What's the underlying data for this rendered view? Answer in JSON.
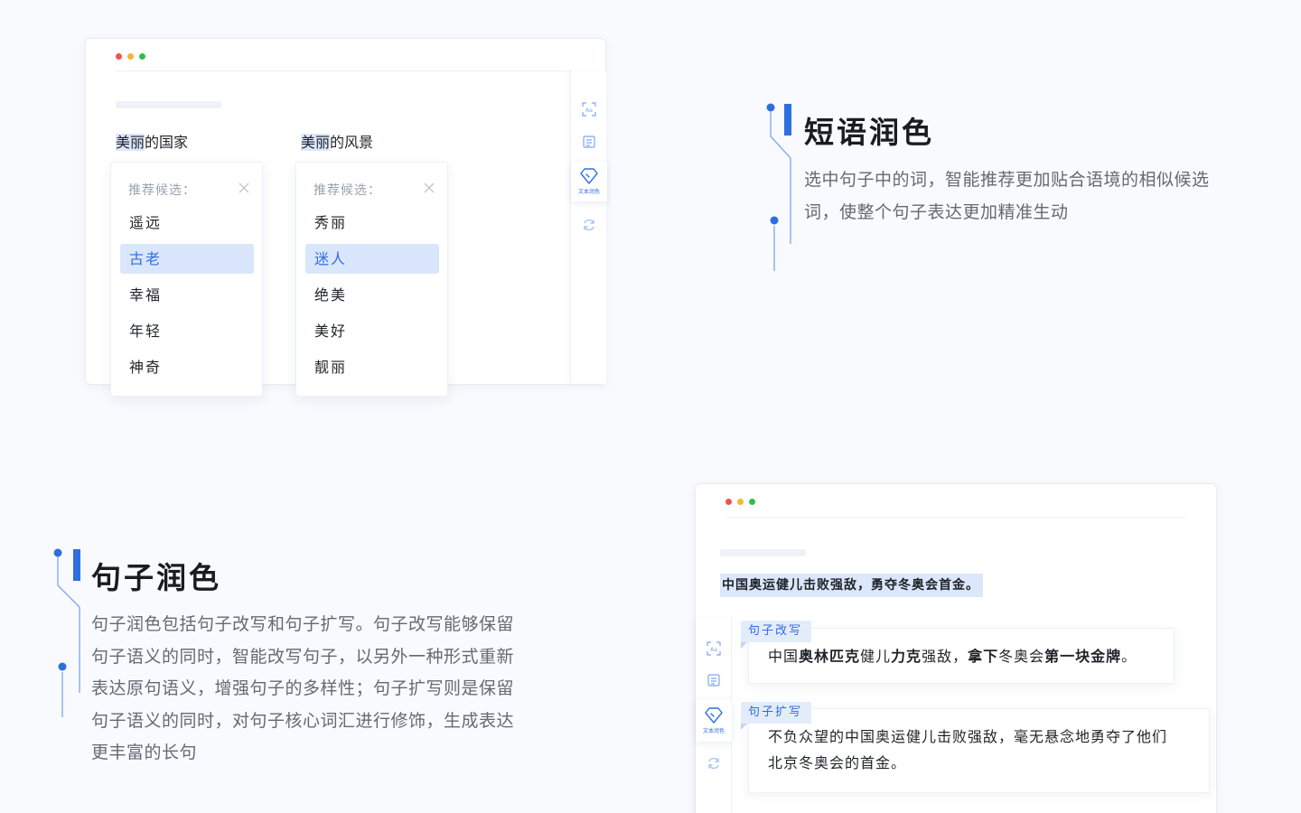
{
  "colors": {
    "accent": "#2f6ee0",
    "dot_red": "#f0544f",
    "dot_yellow": "#f5b72f",
    "dot_green": "#2cc04e"
  },
  "window1": {
    "groups": [
      {
        "head_highlight": "美丽",
        "head_rest": "的国家",
        "title": "推荐候选：",
        "items": [
          "遥远",
          "古老",
          "幸福",
          "年轻",
          "神奇"
        ],
        "selected_index": 1
      },
      {
        "head_highlight": "美丽",
        "head_rest": "的风景",
        "title": "推荐候选：",
        "items": [
          "秀丽",
          "迷人",
          "绝美",
          "美好",
          "靓丽"
        ],
        "selected_index": 1
      }
    ],
    "toolbar": {
      "items": [
        {
          "icon": "text-recognition-icon"
        },
        {
          "icon": "document-icon"
        },
        {
          "icon": "diamond-polish-icon",
          "label": "文本润色",
          "active": true
        },
        {
          "icon": "refresh-icon"
        }
      ]
    }
  },
  "feature_phrase": {
    "title": "短语润色",
    "desc_line1": "选中句子中的词，智能推荐更加贴合语境的相似候选",
    "desc_line2": "词，使整个句子表达更加精准生动"
  },
  "feature_sentence": {
    "title": "句子润色",
    "desc_lines": [
      "句子润色包括句子改写和句子扩写。句子改写能够保留",
      "句子语义的同时，智能改写句子，以另外一种形式重新",
      "表达原句语义，增强句子的多样性；句子扩写则是保留",
      "句子语义的同时，对句子核心词汇进行修饰，生成表达",
      "更丰富的长句"
    ]
  },
  "window2": {
    "selected_sentence": "中国奥运健儿击败强敌，勇夺冬奥会首金。",
    "rewrite": {
      "tag": "句子改写",
      "parts": [
        "中国",
        "奥林匹克",
        "健儿",
        "力克",
        "强敌，",
        "拿下",
        "冬奥会",
        "第一块金牌",
        "。"
      ]
    },
    "expand": {
      "tag": "句子扩写",
      "line1": "不负众望的中国奥运健儿击败强敌，毫无悬念地勇夺了他们",
      "line2": "北京冬奥会的首金。"
    },
    "toolbar": {
      "items": [
        {
          "icon": "text-recognition-icon"
        },
        {
          "icon": "document-icon"
        },
        {
          "icon": "diamond-polish-icon",
          "label": "文本润色",
          "active": true
        },
        {
          "icon": "refresh-icon"
        }
      ]
    }
  }
}
